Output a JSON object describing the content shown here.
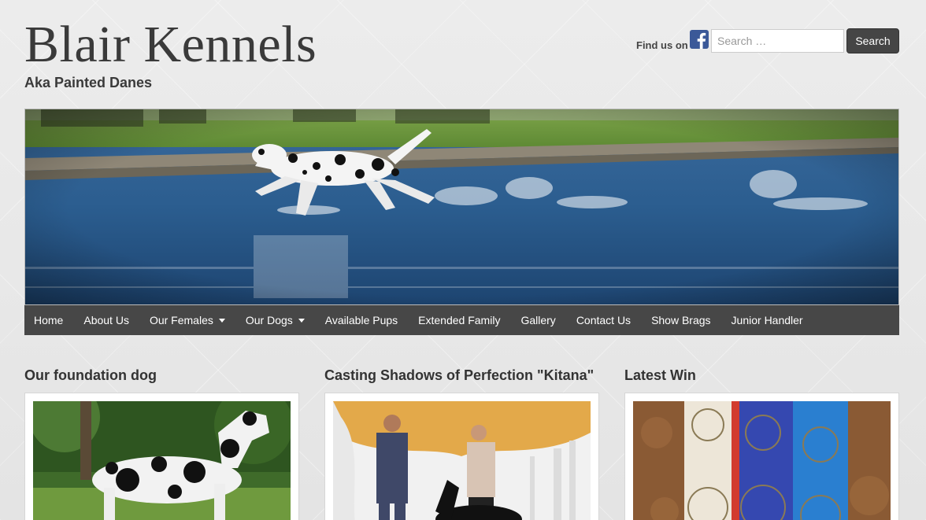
{
  "header": {
    "site_title": "Blair Kennels",
    "tagline": "Aka Painted Danes",
    "find_us": "Find us on",
    "facebook_icon": "facebook-icon"
  },
  "search": {
    "placeholder": "Search …",
    "button_label": "Search"
  },
  "banner": {
    "image": "great-dane-running-through-pond"
  },
  "nav": {
    "items": [
      {
        "label": "Home",
        "dropdown": false
      },
      {
        "label": "About Us",
        "dropdown": false
      },
      {
        "label": "Our Females",
        "dropdown": true
      },
      {
        "label": "Our Dogs",
        "dropdown": true
      },
      {
        "label": "Available Pups",
        "dropdown": false
      },
      {
        "label": "Extended Family",
        "dropdown": false
      },
      {
        "label": "Gallery",
        "dropdown": false
      },
      {
        "label": "Contact Us",
        "dropdown": false
      },
      {
        "label": "Show Brags",
        "dropdown": false
      },
      {
        "label": "Junior Handler",
        "dropdown": false
      }
    ]
  },
  "widgets": [
    {
      "title": "Our foundation dog",
      "image": "harlequin-great-dane-standing"
    },
    {
      "title": "Casting Shadows of Perfection \"Kitana\"",
      "image": "dog-show-win-photo"
    },
    {
      "title": "Latest Win",
      "image": "show-ribbons"
    }
  ],
  "colors": {
    "nav_bg": "#474747",
    "search_button_bg": "#454545",
    "facebook_blue": "#3b5998"
  }
}
